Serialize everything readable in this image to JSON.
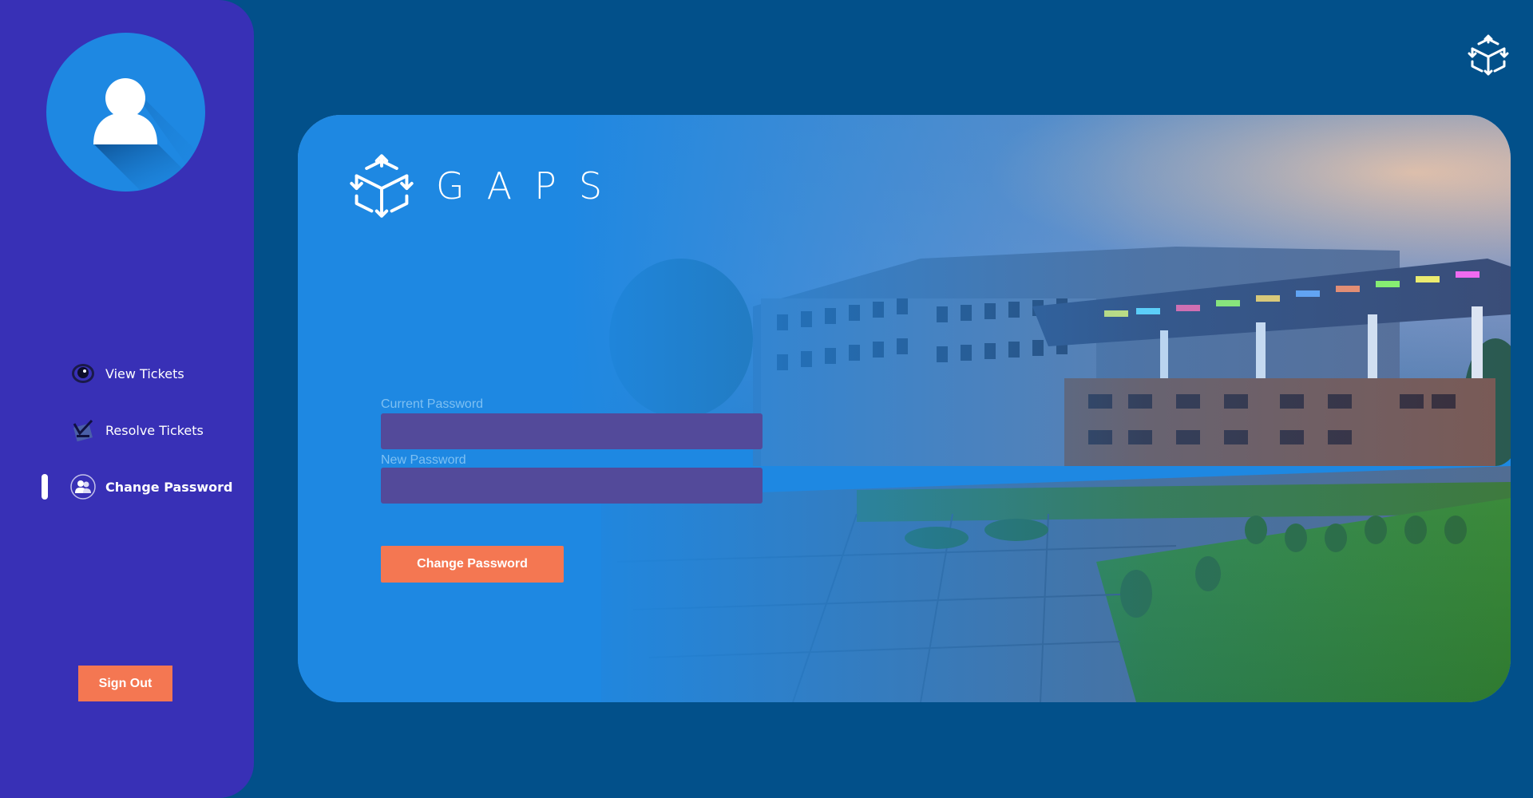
{
  "sidebar": {
    "avatar_icon": "user-icon",
    "nav": [
      {
        "label": "View Tickets",
        "icon": "eye-icon"
      },
      {
        "label": "Resolve Tickets",
        "icon": "notepad-icon"
      },
      {
        "label": "Change Password",
        "icon": "users-icon",
        "active": true
      }
    ],
    "signout_label": "Sign Out"
  },
  "brand": {
    "name": "GAPS",
    "logo_icon": "cube-logo-icon"
  },
  "form": {
    "current_password_label": "Current Password",
    "new_password_label": "New Password",
    "submit_label": "Change Password"
  },
  "colors": {
    "background": "#02508a",
    "sidebar": "#3830b6",
    "accent": "#f47752",
    "card": "#1e88e2",
    "input": "#534a9a"
  }
}
